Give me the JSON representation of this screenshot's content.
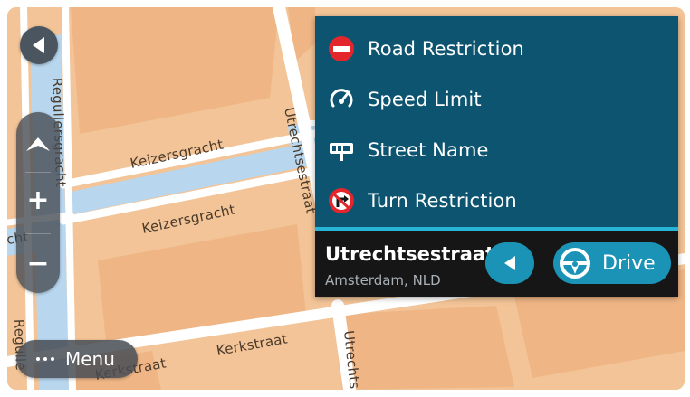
{
  "map": {
    "street_labels": {
      "keizersgracht_upper": "Keizersgracht",
      "keizersgracht_lower": "Keizersgracht",
      "utrechtsestraat_top": "Utrechtsestraat",
      "utrechtsestraat_bottom": "Utrechtse",
      "reguliersgracht_top": "Reguliersgracht",
      "reguliersgracht_bottom": "Regulie",
      "kerkstraat_right": "Kerkstraat",
      "kerkstraat_left": "Kerkstraat",
      "partial_left": "cht"
    },
    "colors": {
      "land": "#f2c497",
      "blocks": "#efb585",
      "roads": "#ffffff",
      "water": "#b8d7ef"
    }
  },
  "controls": {
    "back_icon": "chevron-left-icon",
    "tilt_icon": "chevron-up-icon",
    "zoom_in_label": "+",
    "zoom_out_label": "−",
    "menu_label": "Menu",
    "menu_icon": "dots-icon"
  },
  "popup": {
    "items": [
      {
        "label": "Road Restriction",
        "icon": "no-entry-icon"
      },
      {
        "label": "Speed Limit",
        "icon": "speedometer-icon"
      },
      {
        "label": "Street Name",
        "icon": "street-sign-icon"
      },
      {
        "label": "Turn Restriction",
        "icon": "no-right-turn-icon"
      }
    ],
    "location": {
      "street": "Utrechtsestraat",
      "city": "Amsterdam, NLD"
    },
    "actions": {
      "back_icon": "chevron-left-icon",
      "drive_label": "Drive",
      "drive_icon": "steering-wheel-icon"
    },
    "colors": {
      "panel": "#0c5470",
      "accent": "#27b5d7",
      "footer": "#161616",
      "button": "#1a93b6",
      "restriction_red": "#e3262c"
    }
  }
}
